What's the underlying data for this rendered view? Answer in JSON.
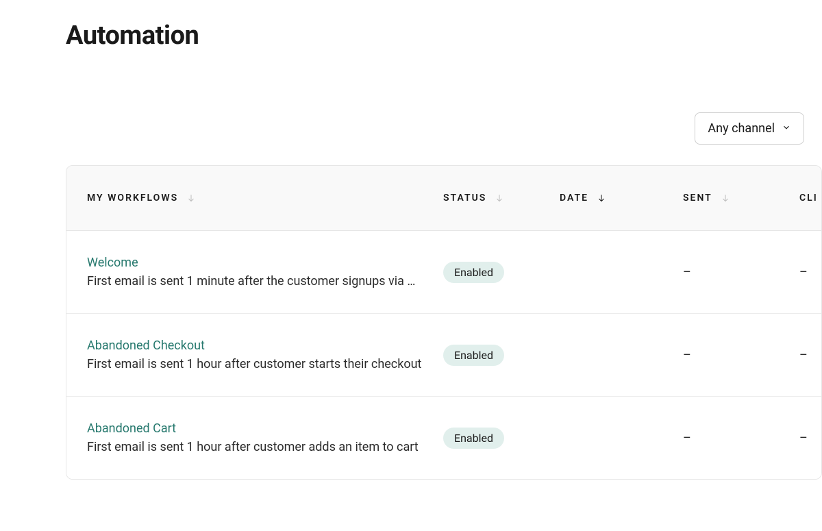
{
  "page": {
    "title": "Automation"
  },
  "filter": {
    "channel_label": "Any channel"
  },
  "table": {
    "headers": {
      "workflows": "MY WORKFLOWS",
      "status": "STATUS",
      "date": "DATE",
      "sent": "SENT",
      "click": "CLI"
    },
    "rows": [
      {
        "title": "Welcome",
        "description": "First email is sent 1 minute after the customer signups via …",
        "status": "Enabled",
        "sent": "–",
        "click": "–"
      },
      {
        "title": "Abandoned Checkout",
        "description": "First email is sent 1 hour after customer starts their checkout",
        "status": "Enabled",
        "sent": "–",
        "click": "–"
      },
      {
        "title": "Abandoned Cart",
        "description": "First email is sent 1 hour after customer adds an item to cart",
        "status": "Enabled",
        "sent": "–",
        "click": "–"
      }
    ]
  }
}
